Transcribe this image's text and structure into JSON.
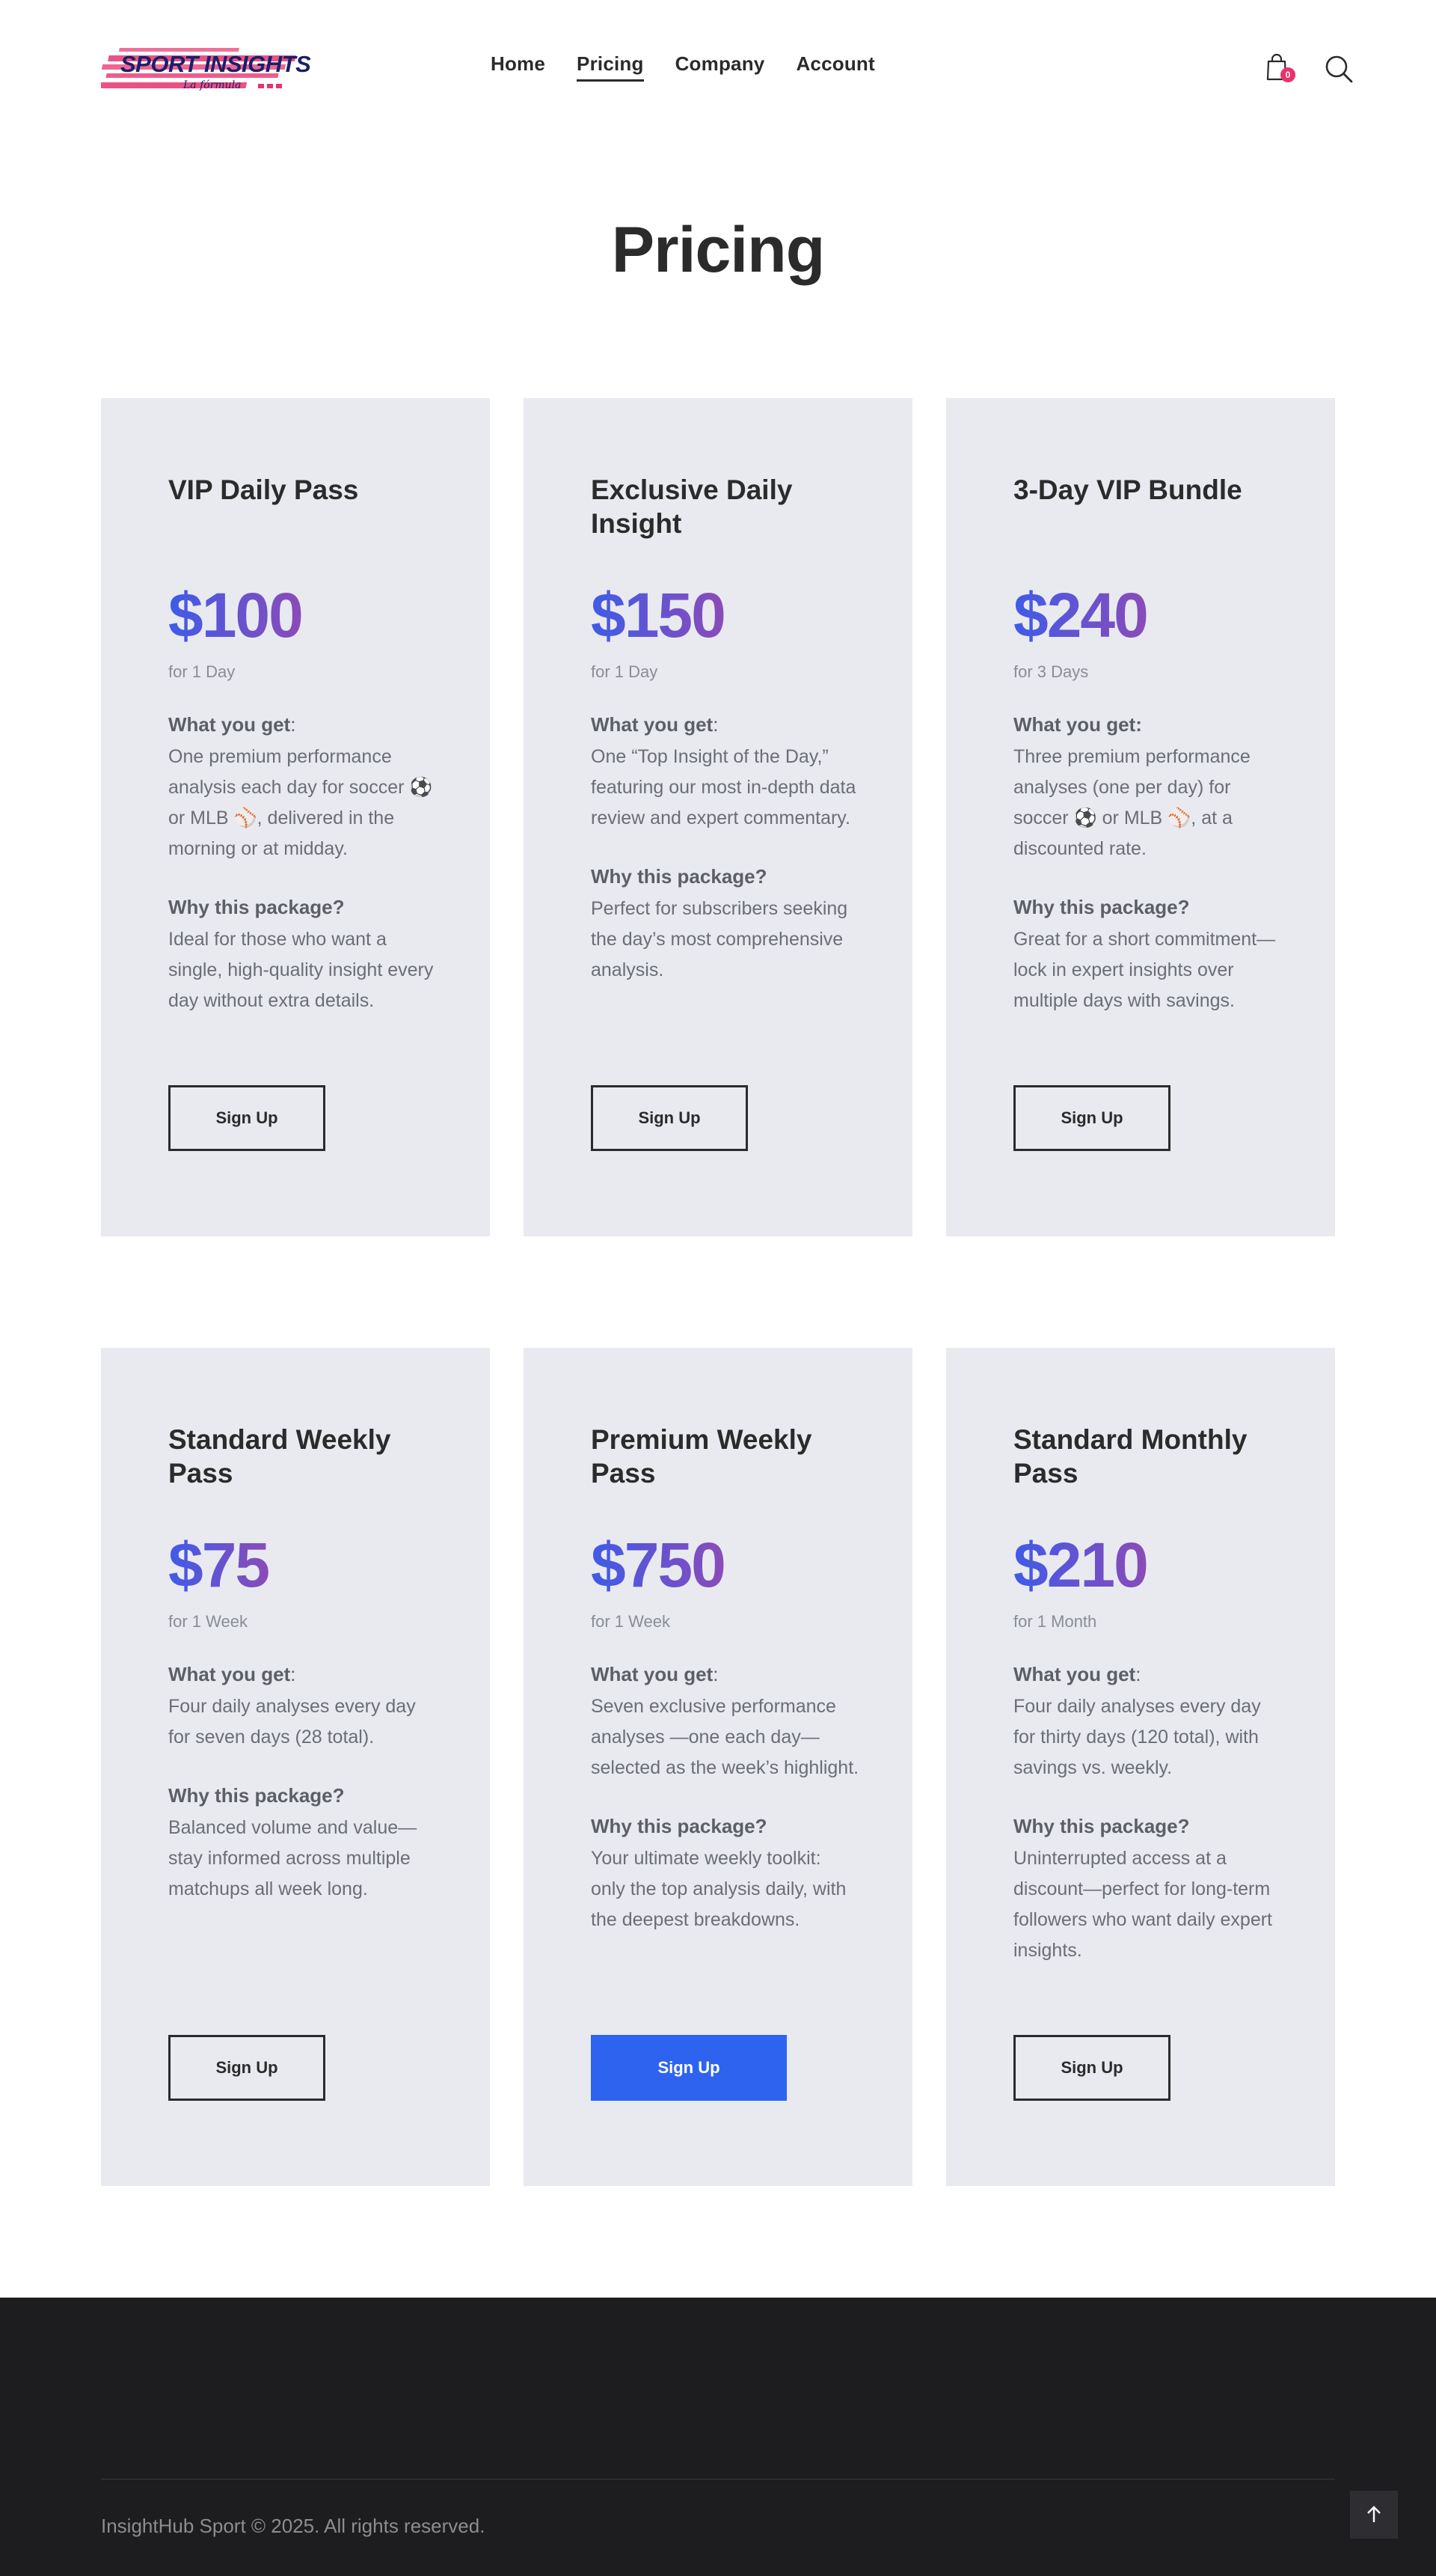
{
  "header": {
    "logo": {
      "main_text": "SPORT INSIGHTS",
      "tagline": "La fórmula"
    },
    "nav": [
      {
        "label": "Home",
        "active": false
      },
      {
        "label": "Pricing",
        "active": true
      },
      {
        "label": "Company",
        "active": false
      },
      {
        "label": "Account",
        "active": false
      }
    ],
    "cart_count": "0",
    "cart_icon": "shopping-bag-icon",
    "search_icon": "search-icon"
  },
  "page_title": "Pricing",
  "plans": [
    {
      "title": "VIP Daily Pass",
      "price": "$100",
      "period": "for 1 Day",
      "what_label": "What you get",
      "what_text": "One premium performance analysis each day for soccer ⚽ or MLB ⚾, delivered in the morning or at midday.",
      "why_label": "Why this package?",
      "why_text": "Ideal for those who want a single, high-quality insight every day without extra details.",
      "button": "Sign Up",
      "highlighted": false
    },
    {
      "title": "Exclusive Daily Insight",
      "price": "$150",
      "period": "for 1 Day",
      "what_label": "What you get",
      "what_text": "One “Top Insight of the Day,” featuring our most in-depth data review and expert commentary.",
      "why_label": "Why this package?",
      "why_text": "Perfect for subscribers seeking the day’s most comprehensive analysis.",
      "button": "Sign Up",
      "highlighted": false
    },
    {
      "title": "3-Day VIP Bundle",
      "price": "$240",
      "period": "for 3 Days",
      "what_label": "What you get:",
      "what_text": "Three premium performance analyses (one per day) for soccer ⚽ or MLB ⚾, at a discounted rate.",
      "why_label": "Why this package?",
      "why_text": "Great for a short commitment—lock in expert insights over multiple days with savings.",
      "button": "Sign Up",
      "highlighted": false
    },
    {
      "title": "Standard Weekly Pass",
      "price": "$75",
      "period": "for 1 Week",
      "what_label": "What you get",
      "what_text": "Four daily analyses every day for seven days (28 total).",
      "why_label": "Why this package?",
      "why_text": "Balanced volume and value—stay informed across multiple matchups all week long.",
      "button": "Sign Up",
      "highlighted": false
    },
    {
      "title": "Premium Weekly Pass",
      "price": "$750",
      "period": "for 1 Week",
      "what_label": "What you get",
      "what_text": "Seven exclusive performance analyses —one each day— selected as the week’s highlight.",
      "why_label": "Why this package?",
      "why_text": "Your ultimate weekly toolkit: only the top analysis daily, with the deepest breakdowns.",
      "button": "Sign Up",
      "highlighted": true
    },
    {
      "title": "Standard Monthly Pass",
      "price": "$210",
      "period": "for 1 Month",
      "what_label": "What you get",
      "what_text": "Four daily analyses every day for thirty days (120 total), with savings vs. weekly.",
      "why_label": "Why this package?",
      "why_text": "Uninterrupted access at a discount—perfect for long-term followers who want daily expert insights.",
      "button": "Sign Up",
      "highlighted": false
    }
  ],
  "footer": {
    "copyright": "InsightHub Sport © 2025. All rights reserved.",
    "to_top_icon": "arrow-up-icon"
  },
  "colors": {
    "card_bg": "#e8eaf0",
    "price_gradient_start": "#3f5be8",
    "price_gradient_end": "#8b4bb8",
    "primary_button": "#2e63f0",
    "footer_bg": "#1d1d20",
    "badge": "#e8336d"
  }
}
